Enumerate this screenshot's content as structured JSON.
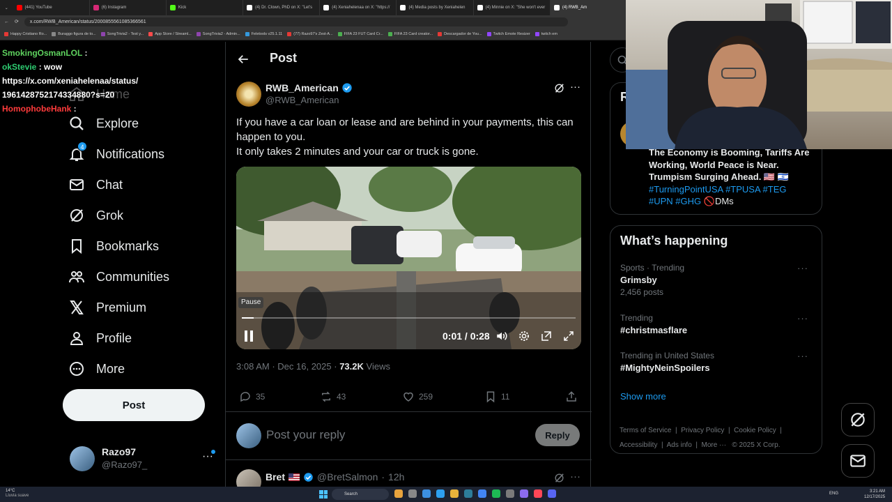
{
  "browser": {
    "tabs": [
      {
        "title": "(441) YouTube",
        "color": "#ff0000"
      },
      {
        "title": "(6) Instagram",
        "color": "#d62976"
      },
      {
        "title": "Kick",
        "color": "#53fc18"
      },
      {
        "title": "(4) Dr. Clown, PhD on X: \"Let's",
        "color": "#ffffff"
      },
      {
        "title": "(4) Xeniahelenaa on X: \"https://",
        "color": "#ffffff"
      },
      {
        "title": "(4) Media posts by Xeniahelen",
        "color": "#ffffff"
      },
      {
        "title": "(4) Minnie on X: \"She won't ever",
        "color": "#ffffff"
      },
      {
        "title": "(4) RWB_Am",
        "color": "#ffffff"
      }
    ],
    "url": "x.com/RWB_American/status/2000855561085366561",
    "bookmarks": [
      {
        "label": "Happy Cristiano Ro...",
        "color": "#e53935"
      },
      {
        "label": "Buraggo figura de to...",
        "color": "#888888"
      },
      {
        "label": "SongTrivia2 - Test y...",
        "color": "#8e44ad"
      },
      {
        "label": "App Store / Streaml...",
        "color": "#ff4b4b"
      },
      {
        "label": "SongTrivia2 - Admin...",
        "color": "#8e44ad"
      },
      {
        "label": "Feletools v25.1.11",
        "color": "#3498db"
      },
      {
        "label": "(77) Razo97's Zest-A...",
        "color": "#e53935"
      },
      {
        "label": "FIFA 23 FUT Card Cr...",
        "color": "#4caf50"
      },
      {
        "label": "FIFA 23 Card creator...",
        "color": "#4caf50"
      },
      {
        "label": "Descargador de You...",
        "color": "#e53935"
      },
      {
        "label": "Twitch Emote Resizer",
        "color": "#9146ff"
      },
      {
        "label": "twitch em",
        "color": "#9146ff"
      }
    ]
  },
  "chat": [
    {
      "user": "SmokingOsmanLOL",
      "user_color": "#5fd35f",
      "sep": " :",
      "text": ""
    },
    {
      "user": "okStevie",
      "user_color": "#2ecc71",
      "sep": " :",
      "text": " wow"
    },
    {
      "user": "",
      "user_color": "#ffffff",
      "sep": "",
      "text": "https://x.com/xeniahelenaa/status/"
    },
    {
      "user": "",
      "user_color": "#ffffff",
      "sep": "",
      "text": "1961428752174334880?s=20"
    },
    {
      "user": "HomophobeHank",
      "user_color": "#ff3b3b",
      "sep": " :",
      "text": ""
    }
  ],
  "nav": {
    "home": "Home",
    "explore": "Explore",
    "notifications": "Notifications",
    "notifications_badge": "4",
    "chat": "Chat",
    "grok": "Grok",
    "bookmarks": "Bookmarks",
    "communities": "Communities",
    "premium": "Premium",
    "profile": "Profile",
    "more": "More",
    "post_button": "Post"
  },
  "account": {
    "name": "Razo97",
    "handle": "@Razo97_"
  },
  "post": {
    "header": "Post",
    "author_name": "RWB_American",
    "author_handle": "@RWB_American",
    "text_line1": "If you have a car loan or lease and are behind in your payments, this can happen to you.",
    "text_line2": "It only takes 2 minutes and your car or truck is gone.",
    "video": {
      "pause_tooltip": "Pause",
      "time": "0:01 / 0:28",
      "progress": 0.036
    },
    "time": "3:08 AM",
    "date": "Dec 16, 2025",
    "views_count": "73.2K",
    "views_label": "Views",
    "replies": "35",
    "reposts": "43",
    "likes": "259",
    "bookmarks": "11"
  },
  "reply": {
    "placeholder": "Post your reply",
    "button": "Reply"
  },
  "next_reply": {
    "name": "Bret",
    "handle": "@BretSalmon",
    "time": "12h"
  },
  "sidebar": {
    "partial_title": "R",
    "promo_text": "The Economy is Booming, Tariffs Are Working, World Peace is Near. Trumpism Surging Ahead. 🇺🇸 🇮🇱",
    "hashtags_line1": "#TurningPointUSA #TPUSA #TEG",
    "hashtags_line2": "#UPN #GHG",
    "dms": "🚫DMs",
    "whats_happening": "What’s happening",
    "trends": [
      {
        "category": "Sports · Trending",
        "name": "Grimsby",
        "count": "2,456 posts"
      },
      {
        "category": "Trending",
        "name": "#christmasflare",
        "count": ""
      },
      {
        "category": "Trending in United States",
        "name": "#MightyNeinSpoilers",
        "count": ""
      }
    ],
    "show_more": "Show more",
    "footer_line1": [
      "Terms of Service",
      "Privacy Policy",
      "Cookie Policy"
    ],
    "footer_line2": [
      "Accessibility",
      "Ads info",
      "More ···",
      "© 2025 X Corp."
    ]
  },
  "taskbar": {
    "weather_temp": "14°C",
    "weather_desc": "Lluvia suave",
    "search": "Search",
    "lang": "ENG",
    "time": "3:21 AM",
    "date": "12/17/2025"
  },
  "colors": {
    "accent": "#1d9bf0",
    "verified": "#1d9bf0",
    "bg": "#000000",
    "border": "#2f3336",
    "muted": "#71767b"
  }
}
